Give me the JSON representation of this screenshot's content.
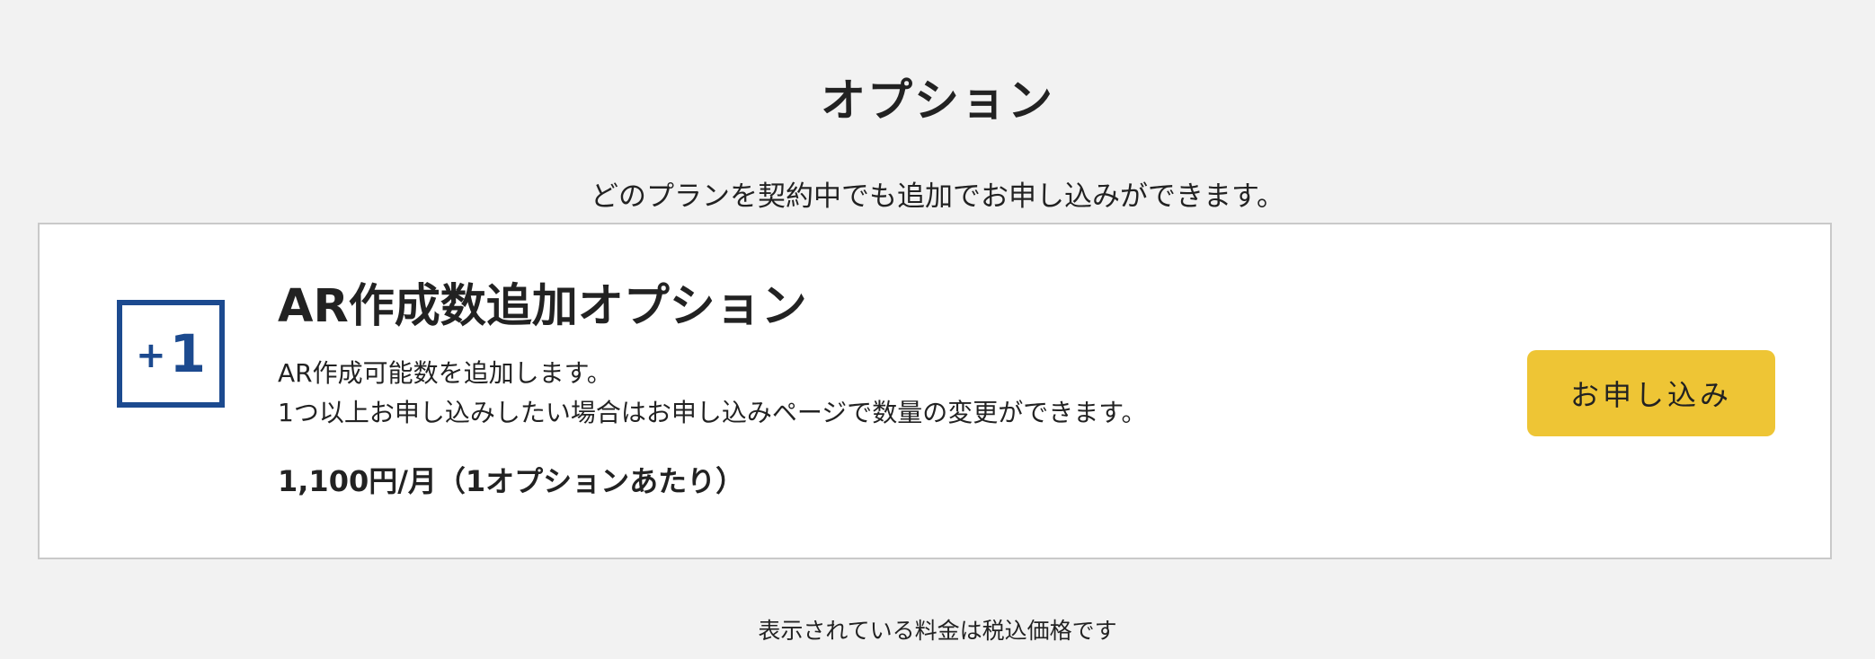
{
  "section": {
    "title": "オプション",
    "lead": "どのプランを契約中でも追加でお申し込みができます。"
  },
  "option": {
    "icon": {
      "name": "plus-one-icon",
      "plus": "+",
      "number": "1",
      "color": "#1c4a8f"
    },
    "name": "AR作成数追加オプション",
    "description_lines": [
      "AR作成可能数を追加します。",
      "1つ以上お申し込みしたい場合はお申し込みページで数量の変更ができます。"
    ],
    "price": "1,100円/月（1オプションあたり）",
    "apply_label": "お申し込み",
    "apply_color": "#eec535"
  },
  "footer": {
    "tax_note": "表示されている料金は税込価格です"
  }
}
